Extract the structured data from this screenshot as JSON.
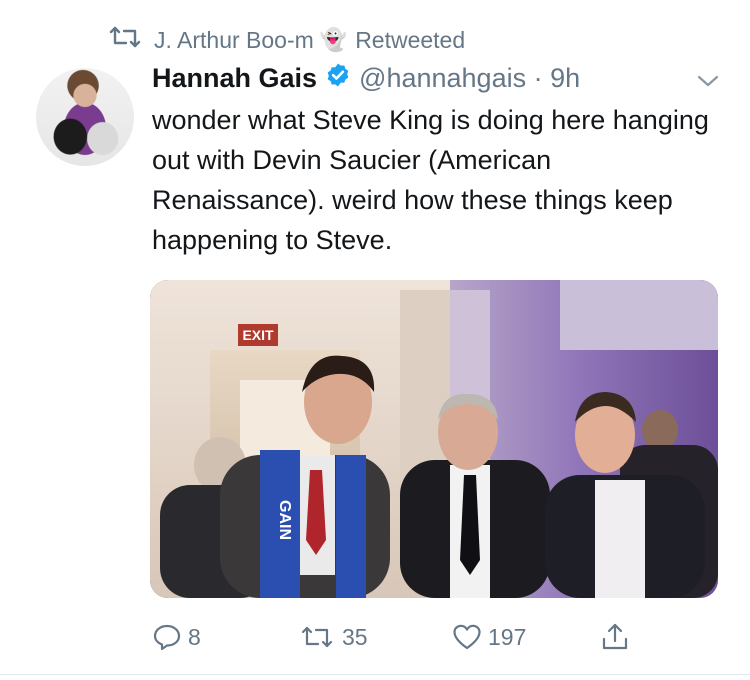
{
  "retweet_context": {
    "retweeter_name": "J. Arthur Boo-m",
    "emoji": "👻",
    "label": "Retweeted"
  },
  "tweet": {
    "author_name": "Hannah Gais",
    "handle_time": "@hannahgais · 9h",
    "text": "wonder what Steve King is doing here hanging out with Devin Saucier (American Renaissance). weird how these things keep happening to Steve.",
    "photo": {
      "sign_text": "EXIT",
      "scarf_text": "GAIN"
    }
  },
  "actions": {
    "reply_count": "8",
    "retweet_count": "35",
    "like_count": "197"
  },
  "colors": {
    "text": "#14171a",
    "secondary": "#657786",
    "verified": "#1da1f2"
  }
}
